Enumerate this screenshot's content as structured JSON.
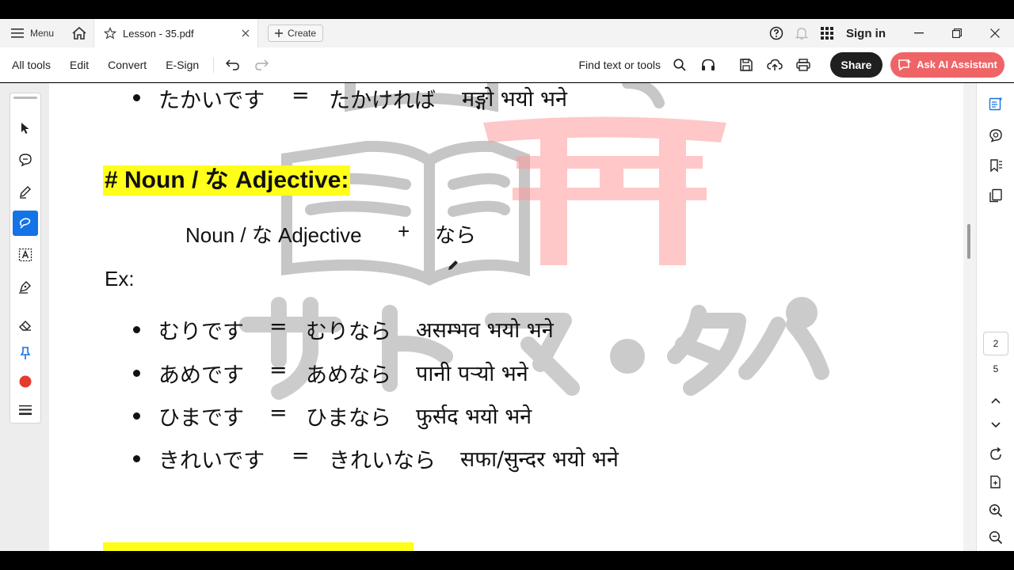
{
  "tabbar": {
    "menu_label": "Menu",
    "tab_title": "Lesson - 35.pdf",
    "create_label": "Create",
    "signin_label": "Sign in"
  },
  "toolbar": {
    "items": [
      "All tools",
      "Edit",
      "Convert",
      "E-Sign"
    ],
    "find_label": "Find text or tools",
    "share_label": "Share",
    "ai_label": "Ask AI Assistant"
  },
  "document": {
    "top_line": {
      "jp1": "たかいです",
      "eq": "=",
      "jp2": "たかければ",
      "np": "मङ्गो भयो भने"
    },
    "heading": "# Noun / な Adjective:",
    "formula": {
      "left": "Noun / な Adjective",
      "plus": "+",
      "right": "なら"
    },
    "ex_label": "Ex:",
    "examples": [
      {
        "jp1": "むりです",
        "eq": "=",
        "jp2": "むりなら",
        "np": "असम्भव भयो भने"
      },
      {
        "jp1": "あめです",
        "eq": "=",
        "jp2": "あめなら",
        "np": "पानी पऱ्यो भने"
      },
      {
        "jp1": "ひまです",
        "eq": "=",
        "jp2": "ひまなら",
        "np": "फुर्सद भयो भने"
      },
      {
        "jp1": "きれいです",
        "eq": "=",
        "jp2": "きれいなら",
        "np": "सफा/सुन्दर भयो भने"
      }
    ]
  },
  "pager": {
    "current": "2",
    "total": "5"
  },
  "colors": {
    "accent": "#1473e6",
    "ai": "#ef6466",
    "highlight": "#ffff1a",
    "share": "#1f1f1f"
  }
}
